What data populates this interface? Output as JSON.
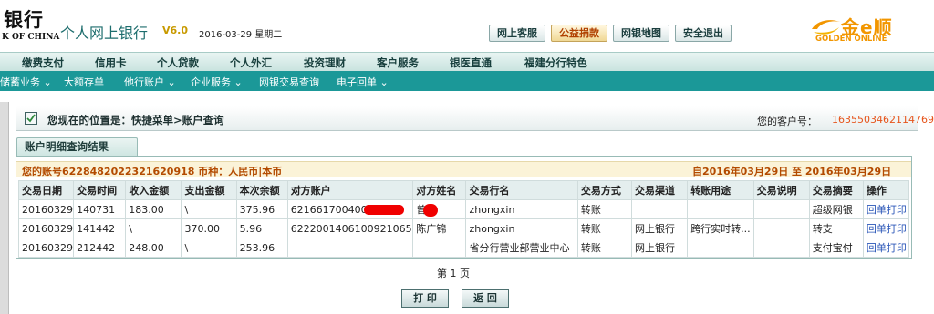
{
  "header": {
    "bank_name": "银行",
    "bank_name_en": "K OF CHINA",
    "site_title": "个人网上银行",
    "version": "V6.0",
    "date": "2016-03-29 星期二",
    "top_buttons": [
      "网上客服",
      "公益捐款",
      "网银地图",
      "安全退出"
    ],
    "golden_logo": "金e顺",
    "golden_logo_sub": "GOLDEN ONLINE"
  },
  "nav_main": [
    "缴费支付",
    "信用卡",
    "个人贷款",
    "个人外汇",
    "投资理财",
    "客户服务",
    "银医直通",
    "福建分行特色"
  ],
  "nav_sub": [
    "储蓄业务 ⌄",
    "大额存单",
    "他行账户 ⌄",
    "企业服务 ⌄",
    "网银交易查询",
    "电子回单 ⌄"
  ],
  "location": {
    "text": "您现在的位置是：快捷菜单>账户查询",
    "customer_label": "您的客户号：",
    "customer_no": "1635503462114769"
  },
  "result": {
    "tab_label": "账户明细查询结果",
    "account_info": "您的账号6228482022321620918 币种：人民币|本币",
    "date_range": "自2016年03月29日  至  2016年03月29日",
    "columns": [
      "交易日期",
      "交易时间",
      "收入金额",
      "支出金额",
      "本次余额",
      "对方账户",
      "对方姓名",
      "交易行名",
      "交易方式",
      "交易渠道",
      "转账用途",
      "交易说明",
      "交易摘要",
      "操作"
    ],
    "rows": [
      {
        "date": "20160329",
        "time": "140731",
        "income": "183.00",
        "expense": "\\",
        "balance": "375.96",
        "counter_account": "621661700400",
        "counter_name": "曾",
        "bank_name": "zhongxin",
        "method": "转账",
        "channel": "",
        "purpose": "",
        "note": "",
        "summary": "超级网银",
        "action": "回单打印"
      },
      {
        "date": "20160329",
        "time": "141442",
        "income": "\\",
        "expense": "370.00",
        "balance": "5.96",
        "counter_account": "6222001406100921065",
        "counter_name": "陈广锦",
        "bank_name": "zhongxin",
        "method": "转账",
        "channel": "网上银行",
        "purpose": "跨行实时转...",
        "note": "",
        "summary": "转支",
        "action": "回单打印"
      },
      {
        "date": "20160329",
        "time": "212442",
        "income": "248.00",
        "expense": "\\",
        "balance": "253.96",
        "counter_account": "",
        "counter_name": "",
        "bank_name": "省分行营业部营业中心",
        "method": "转账",
        "channel": "网上银行",
        "purpose": "",
        "note": "",
        "summary": "支付宝付",
        "action": "回单打印"
      }
    ],
    "pager": "第 1 页",
    "print_button": "打 印",
    "back_button": "返 回"
  },
  "colors": {
    "nav_teal": "#1b9898",
    "accent_orange": "#e6541b",
    "account_text": "#b34a00",
    "golden": "#f29600",
    "redaction": "#f00000"
  }
}
